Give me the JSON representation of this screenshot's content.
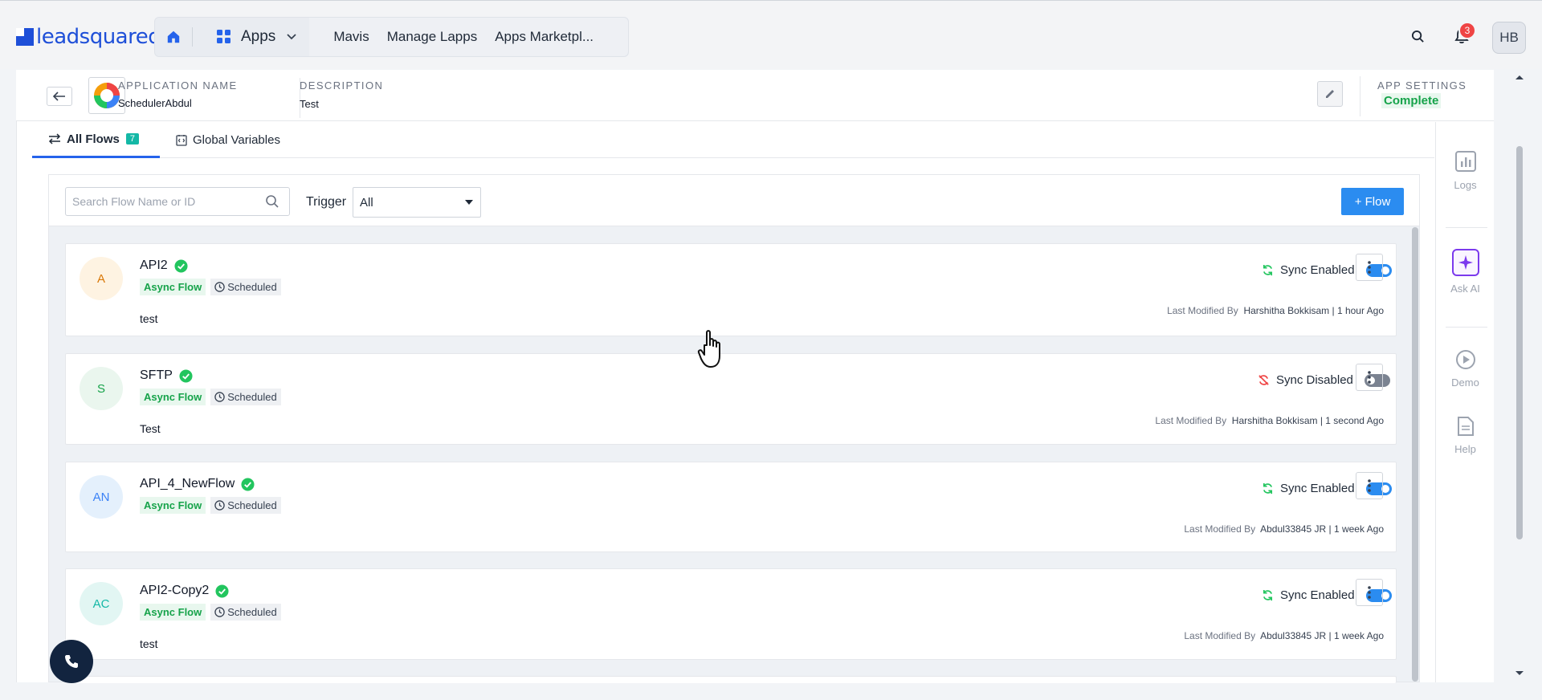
{
  "header": {
    "logo_text": "leadsquared",
    "apps_label": "Apps",
    "nav_links": [
      "Mavis",
      "Manage Lapps",
      "Apps Marketpl..."
    ],
    "notification_count": "3",
    "user_initials": "HB"
  },
  "app": {
    "name_label": "APPLICATION NAME",
    "name": "SchedulerAbdul",
    "description_label": "DESCRIPTION",
    "description": "Test",
    "settings_label": "APP SETTINGS",
    "settings_status": "Complete"
  },
  "tabs": {
    "all_flows": "All Flows",
    "all_flows_count": "7",
    "global_variables": "Global Variables"
  },
  "filters": {
    "search_placeholder": "Search Flow Name or ID",
    "trigger_label": "Trigger",
    "trigger_value": "All",
    "add_flow_label": "+ Flow"
  },
  "flows": [
    {
      "initials": "A",
      "name": "API2",
      "type": "Async Flow",
      "trigger": "Scheduled",
      "description": "test",
      "sync_label": "Sync Enabled",
      "sync_enabled": true,
      "modified_prefix": "Last Modified By",
      "modified_by": "Harshitha Bokkisam | 1 hour Ago"
    },
    {
      "initials": "S",
      "name": "SFTP",
      "type": "Async Flow",
      "trigger": "Scheduled",
      "description": "Test",
      "sync_label": "Sync Disabled",
      "sync_enabled": false,
      "modified_prefix": "Last Modified By",
      "modified_by": "Harshitha Bokkisam | 1 second Ago"
    },
    {
      "initials": "AN",
      "name": "API_4_NewFlow",
      "type": "Async Flow",
      "trigger": "Scheduled",
      "description": "",
      "sync_label": "Sync Enabled",
      "sync_enabled": true,
      "modified_prefix": "Last Modified By",
      "modified_by": "Abdul33845 JR | 1 week Ago"
    },
    {
      "initials": "AC",
      "name": "API2-Copy2",
      "type": "Async Flow",
      "trigger": "Scheduled",
      "description": "test",
      "sync_label": "Sync Enabled",
      "sync_enabled": true,
      "modified_prefix": "Last Modified By",
      "modified_by": "Abdul33845 JR | 1 week Ago"
    }
  ],
  "rail": {
    "logs": "Logs",
    "ask_ai": "Ask AI",
    "demo": "Demo",
    "help": "Help"
  },
  "colors": {
    "primary": "#2b8cf0",
    "success": "#16a34a",
    "danger": "#ef4444",
    "brand": "#1e4fd8"
  }
}
